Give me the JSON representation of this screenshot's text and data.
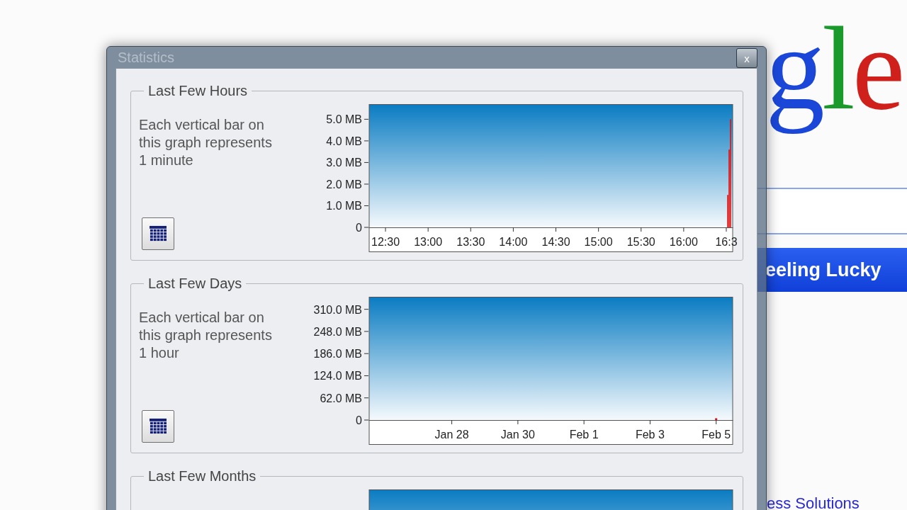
{
  "background_page": {
    "logo": [
      {
        "letter": "g",
        "color": "#1a47d8"
      },
      {
        "letter": "l",
        "color": "#1a9a2a"
      },
      {
        "letter": "e",
        "color": "#d0201b"
      }
    ],
    "lucky_button": "eeling Lucky",
    "footer_link": "ess Solutions"
  },
  "dialog": {
    "title": "Statistics",
    "close": "x",
    "groups": [
      {
        "title": "Last Few Hours",
        "description": "Each vertical bar on this graph represents 1 minute",
        "chart_data": {
          "type": "bar",
          "categories": [
            null,
            null,
            null,
            null,
            null,
            null,
            null,
            null,
            null,
            null,
            null,
            "12:30",
            null,
            null,
            null,
            null,
            null,
            null,
            null,
            null,
            null,
            null,
            null,
            null,
            null,
            null,
            null,
            null,
            null,
            null,
            null,
            null,
            null,
            null,
            null,
            null,
            null,
            null,
            null,
            null,
            null,
            "13:00",
            null,
            null,
            null,
            null,
            null,
            null,
            null,
            null,
            null,
            null,
            null,
            null,
            null,
            null,
            null,
            null,
            null,
            null,
            null,
            null,
            null,
            null,
            null,
            null,
            null,
            null,
            null,
            null,
            null,
            "13:30",
            null,
            null,
            null,
            null,
            null,
            null,
            null,
            null,
            null,
            null,
            null,
            null,
            null,
            null,
            null,
            null,
            null,
            null,
            null,
            null,
            null,
            null,
            null,
            null,
            null,
            null,
            null,
            null,
            null,
            "14:00",
            null,
            null,
            null,
            null,
            null,
            null,
            null,
            null,
            null,
            null,
            null,
            null,
            null,
            null,
            null,
            null,
            null,
            null,
            null,
            null,
            null,
            null,
            null,
            null,
            null,
            null,
            null,
            null,
            null,
            "14:30",
            null,
            null,
            null,
            null,
            null,
            null,
            null,
            null,
            null,
            null,
            null,
            null,
            null,
            null,
            null,
            null,
            null,
            null,
            null,
            null,
            null,
            null,
            null,
            null,
            null,
            null,
            null,
            null,
            null,
            "15:00",
            null,
            null,
            null,
            null,
            null,
            null,
            null,
            null,
            null,
            null,
            null,
            null,
            null,
            null,
            null,
            null,
            null,
            null,
            null,
            null,
            null,
            null,
            null,
            null,
            null,
            null,
            null,
            null,
            null,
            "15:30",
            null,
            null,
            null,
            null,
            null,
            null,
            null,
            null,
            null,
            null,
            null,
            null,
            null,
            null,
            null,
            null,
            null,
            null,
            null,
            null,
            null,
            null,
            null,
            null,
            null,
            null,
            null,
            null,
            null,
            "16:00",
            null,
            null,
            null,
            null,
            null,
            null,
            null,
            null,
            null,
            null,
            null,
            null,
            null,
            null,
            null,
            null,
            null,
            null,
            null,
            null,
            null,
            null,
            null,
            null,
            null,
            null,
            null,
            null,
            null,
            "16:3",
            null,
            null,
            null,
            null
          ],
          "values": [
            null,
            null,
            null,
            null,
            null,
            null,
            null,
            null,
            null,
            null,
            null,
            null,
            null,
            null,
            null,
            null,
            null,
            null,
            null,
            null,
            null,
            null,
            null,
            null,
            null,
            null,
            null,
            null,
            null,
            null,
            null,
            null,
            null,
            null,
            null,
            null,
            null,
            null,
            null,
            null,
            null,
            null,
            null,
            null,
            null,
            null,
            null,
            null,
            null,
            null,
            null,
            null,
            null,
            null,
            null,
            null,
            null,
            null,
            null,
            null,
            null,
            null,
            null,
            null,
            null,
            null,
            null,
            null,
            null,
            null,
            null,
            null,
            null,
            null,
            null,
            null,
            null,
            null,
            null,
            null,
            null,
            null,
            null,
            null,
            null,
            null,
            null,
            null,
            null,
            null,
            null,
            null,
            null,
            null,
            null,
            null,
            null,
            null,
            null,
            null,
            null,
            null,
            null,
            null,
            null,
            null,
            null,
            null,
            null,
            null,
            null,
            null,
            null,
            null,
            null,
            null,
            null,
            null,
            null,
            null,
            null,
            null,
            null,
            null,
            null,
            null,
            null,
            null,
            null,
            null,
            null,
            null,
            null,
            null,
            null,
            null,
            null,
            null,
            null,
            null,
            null,
            null,
            null,
            null,
            null,
            null,
            null,
            null,
            null,
            null,
            null,
            null,
            null,
            null,
            null,
            null,
            null,
            null,
            null,
            null,
            null,
            null,
            null,
            null,
            null,
            null,
            null,
            null,
            null,
            null,
            null,
            null,
            null,
            null,
            null,
            null,
            null,
            null,
            null,
            null,
            null,
            null,
            null,
            null,
            null,
            null,
            null,
            null,
            null,
            null,
            null,
            null,
            null,
            null,
            null,
            null,
            null,
            null,
            null,
            null,
            null,
            null,
            null,
            null,
            null,
            null,
            null,
            null,
            null,
            null,
            null,
            null,
            null,
            null,
            null,
            null,
            null,
            null,
            null,
            null,
            null,
            null,
            null,
            null,
            null,
            null,
            null,
            null,
            null,
            null,
            null,
            null,
            null,
            null,
            null,
            null,
            null,
            null,
            null,
            null,
            null,
            null,
            null,
            null,
            null,
            null,
            null,
            null,
            null,
            null,
            null,
            null,
            1.5,
            3.6,
            5.0,
            null
          ],
          "ylim": [
            0,
            5.7
          ],
          "yticks": [
            {
              "value": 0,
              "label": "0"
            },
            {
              "value": 1,
              "label": "1.0 MB"
            },
            {
              "value": 2,
              "label": "2.0 MB"
            },
            {
              "value": 3,
              "label": "3.0 MB"
            },
            {
              "value": 4,
              "label": "4.0 MB"
            },
            {
              "value": 5,
              "label": "5.0 MB"
            }
          ]
        }
      },
      {
        "title": "Last Few Days",
        "description": "Each vertical bar on this graph represents 1 hour",
        "chart_data": {
          "type": "bar",
          "categories": [
            null,
            null,
            "Jan 28",
            null,
            "Jan 30",
            null,
            "Feb 1",
            null,
            "Feb 3",
            null,
            "Feb 5"
          ],
          "values": [
            null,
            null,
            null,
            null,
            null,
            null,
            null,
            null,
            null,
            null,
            5
          ],
          "ylim": [
            0,
            345
          ],
          "yticks": [
            {
              "value": 0,
              "label": "0"
            },
            {
              "value": 62,
              "label": "62.0 MB"
            },
            {
              "value": 124,
              "label": "124.0 MB"
            },
            {
              "value": 186,
              "label": "186.0 MB"
            },
            {
              "value": 248,
              "label": "248.0 MB"
            },
            {
              "value": 310,
              "label": "310.0 MB"
            }
          ]
        }
      },
      {
        "title": "Last Few Months"
      }
    ]
  }
}
